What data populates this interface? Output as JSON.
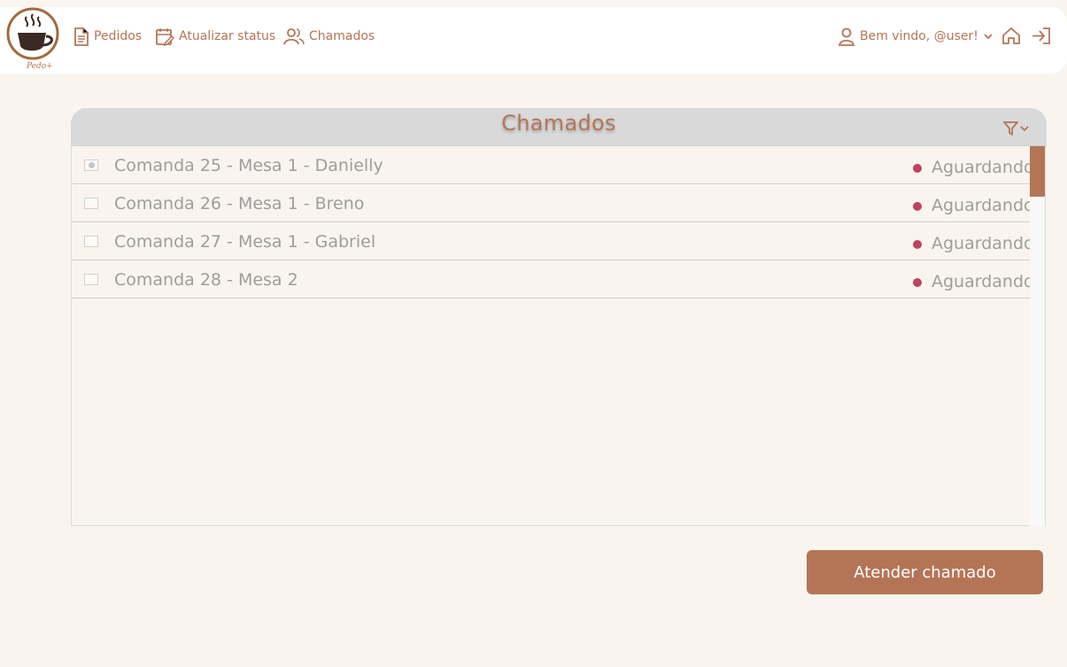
{
  "app": {
    "logo_text": "Pedo+"
  },
  "nav": {
    "items": [
      {
        "label": "Pedidos",
        "icon": "document-icon"
      },
      {
        "label": "Atualizar status",
        "icon": "calendar-edit-icon"
      },
      {
        "label": "Chamados",
        "icon": "users-icon"
      }
    ],
    "user_greeting": "Bem vindo, @user!",
    "home_icon": "home-icon",
    "logout_icon": "logout-icon"
  },
  "panel": {
    "title": "Chamados",
    "filter_icon": "filter-icon"
  },
  "calls": [
    {
      "label": "Comanda 25 - Mesa 1 - Danielly",
      "status": "Aguardando",
      "selected": true
    },
    {
      "label": "Comanda 26 - Mesa 1 - Breno",
      "status": "Aguardando",
      "selected": false
    },
    {
      "label": "Comanda 27 - Mesa 1 - Gabriel",
      "status": "Aguardando",
      "selected": false
    },
    {
      "label": "Comanda 28 - Mesa 2",
      "status": "Aguardando",
      "selected": false
    }
  ],
  "actions": {
    "primary_label": "Atender chamado"
  },
  "colors": {
    "accent": "#b47556",
    "status_waiting": "#c3405f",
    "background": "#f9f5ee"
  }
}
